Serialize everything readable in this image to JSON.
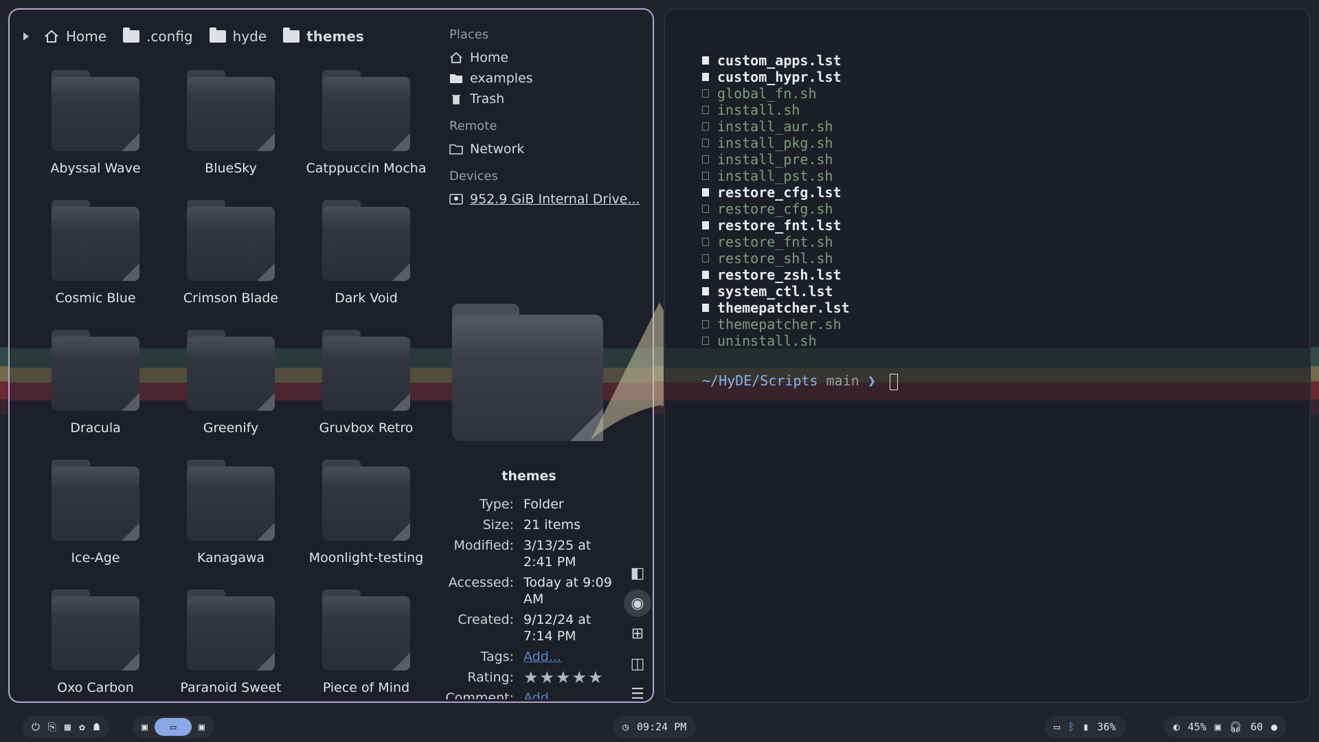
{
  "file_manager": {
    "breadcrumbs": [
      "Home",
      ".config",
      "hyde",
      "themes"
    ],
    "folders": [
      "Abyssal Wave",
      "BlueSky",
      "Catppuccin Mocha",
      "Cosmic Blue",
      "Crimson Blade",
      "Dark Void",
      "Dracula",
      "Greenify",
      "Gruvbox Retro",
      "Ice-Age",
      "Kanagawa",
      "Moonlight-testing",
      "Oxo Carbon",
      "Paranoid Sweet",
      "Piece of Mind"
    ],
    "sidebar": {
      "places_label": "Places",
      "places": [
        "Home",
        "examples",
        "Trash"
      ],
      "remote_label": "Remote",
      "remote": [
        "Network"
      ],
      "devices_label": "Devices",
      "devices": [
        "952.9 GiB Internal Drive..."
      ]
    },
    "preview": {
      "name": "themes",
      "props": [
        {
          "k": "Type:",
          "v": "Folder"
        },
        {
          "k": "Size:",
          "v": "21 items"
        },
        {
          "k": "Modified:",
          "v": "3/13/25 at 2:41 PM"
        },
        {
          "k": "Accessed:",
          "v": "Today at 9:09 AM"
        },
        {
          "k": "Created:",
          "v": "9/12/24 at 7:14 PM"
        },
        {
          "k": "Tags:",
          "v": "Add..."
        },
        {
          "k": "Rating:",
          "v": "★★★★★"
        },
        {
          "k": "Comment:",
          "v": "Add"
        }
      ]
    }
  },
  "terminal": {
    "files": [
      {
        "name": "custom_apps.lst",
        "kind": "lst"
      },
      {
        "name": "custom_hypr.lst",
        "kind": "lst"
      },
      {
        "name": "global_fn.sh",
        "kind": "sh"
      },
      {
        "name": "install.sh",
        "kind": "sh"
      },
      {
        "name": "install_aur.sh",
        "kind": "sh"
      },
      {
        "name": "install_pkg.sh",
        "kind": "sh"
      },
      {
        "name": "install_pre.sh",
        "kind": "sh"
      },
      {
        "name": "install_pst.sh",
        "kind": "sh"
      },
      {
        "name": "restore_cfg.lst",
        "kind": "lst"
      },
      {
        "name": "restore_cfg.sh",
        "kind": "sh"
      },
      {
        "name": "restore_fnt.lst",
        "kind": "lst"
      },
      {
        "name": "restore_fnt.sh",
        "kind": "sh"
      },
      {
        "name": "restore_shl.sh",
        "kind": "sh"
      },
      {
        "name": "restore_zsh.lst",
        "kind": "lst"
      },
      {
        "name": "system_ctl.lst",
        "kind": "lst"
      },
      {
        "name": "themepatcher.lst",
        "kind": "lst"
      },
      {
        "name": "themepatcher.sh",
        "kind": "sh"
      },
      {
        "name": "uninstall.sh",
        "kind": "sh"
      }
    ],
    "prompt_path": "~/HyDE/Scripts",
    "prompt_branch": "main",
    "prompt_arrow": "❯"
  },
  "bar": {
    "clock": "09:24 PM",
    "battery": "36%",
    "brightness": "45%",
    "volume": "60"
  },
  "colors": {
    "accent_border": "#b7a5d1",
    "sh_green": "#7e9d79",
    "prompt_blue": "#8bb3e8",
    "workspace_active": "#8aa7e6"
  }
}
